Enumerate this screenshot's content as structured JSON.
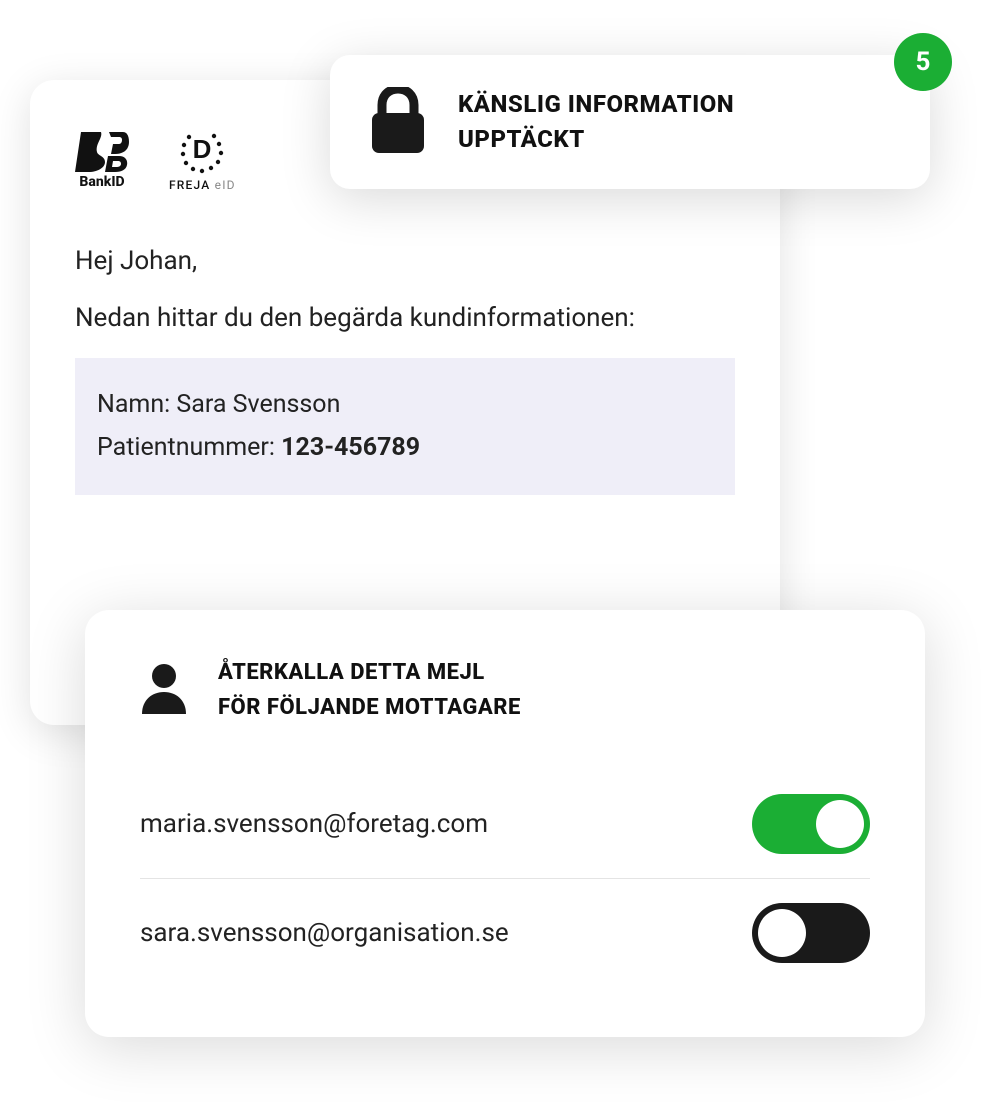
{
  "logos": {
    "bankid_label": "BankID",
    "freja_label": "FREJA",
    "freja_eid": "eID"
  },
  "email": {
    "greeting": "Hej Johan,",
    "intro": "Nedan hittar du den begärda kundinformationen:",
    "name_label": "Namn:",
    "name_value": "Sara Svensson",
    "patientnum_label": "Patientnummer:",
    "patientnum_value": "123-456789"
  },
  "alert": {
    "line1": "KÄNSLIG INFORMATION",
    "line2": "UPPTÄCKT",
    "badge_count": "5"
  },
  "recall": {
    "title_line1": "ÅTERKALLA DETTA MEJL",
    "title_line2": "FÖR FÖLJANDE MOTTAGARE",
    "recipients": [
      {
        "email": "maria.svensson@foretag.com",
        "enabled": true
      },
      {
        "email": "sara.svensson@organisation.se",
        "enabled": false
      }
    ]
  },
  "colors": {
    "accent_green": "#1BAE34",
    "highlight_bg": "#efeef8"
  }
}
